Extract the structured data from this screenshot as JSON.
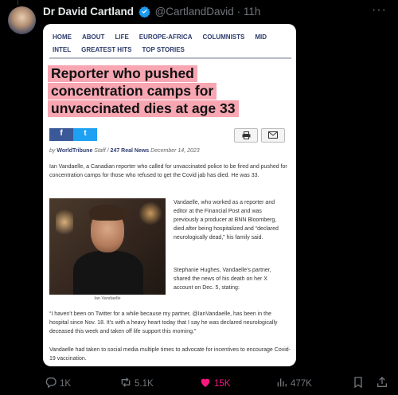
{
  "tweet": {
    "author_name": "Dr David Cartland",
    "handle": "@CartlandDavid",
    "separator": "·",
    "time": "11h",
    "more": "···"
  },
  "article": {
    "nav_row1": [
      "HOME",
      "ABOUT",
      "LIFE",
      "EUROPE-AFRICA",
      "COLUMNISTS",
      "MID"
    ],
    "nav_row2": [
      "INTEL",
      "GREATEST HITS",
      "TOP STORIES"
    ],
    "headline_lines": [
      "Reporter who pushed",
      "concentration camps for",
      "unvaccinated dies at age 33"
    ],
    "share_fb": "f",
    "share_tw": "t",
    "print_icon": "print-icon",
    "email_icon": "mail-icon",
    "byline": {
      "prefix": "by",
      "source": "WorldTribune",
      "role": "Staff /",
      "outlet": "247 Real News",
      "date": "December 14, 2023"
    },
    "para1": "Ian Vandaelle, a Canadian reporter who called for unvaccinated police to be fired and pushed for concentration camps for those who refused to get the Covid jab has died. He was 33.",
    "para2": "Vandaelle, who worked as a reporter and editor at the Financial Post and was previously a producer at BNN Bloomberg, died after being hospitalized and “declared neurologically dead,” his family said.",
    "para3": "Stephanie Hughes, Vandaelle’s partner, shared the news of his death on her X account on Dec. 5, stating:",
    "caption": "Ian Vandaelle",
    "quote": "“I haven’t been on Twitter for a while because my partner, @IanVandaelle, has been in the hospital since Nov. 18. It’s with a heavy heart today that I say he was declared neurologically deceased this week and taken off life support this morning.”",
    "para4": "Vandaelle had taken to social media multiple times to advocate for incentives to encourage Covid-19 vaccination."
  },
  "actions": {
    "replies": "1K",
    "reposts": "5.1K",
    "likes": "15K",
    "views": "477K"
  },
  "colors": {
    "background": "#000000",
    "verified": "#1d9bf0",
    "like": "#f91880",
    "muted": "#71767b",
    "highlight": "#f7a6b2"
  }
}
